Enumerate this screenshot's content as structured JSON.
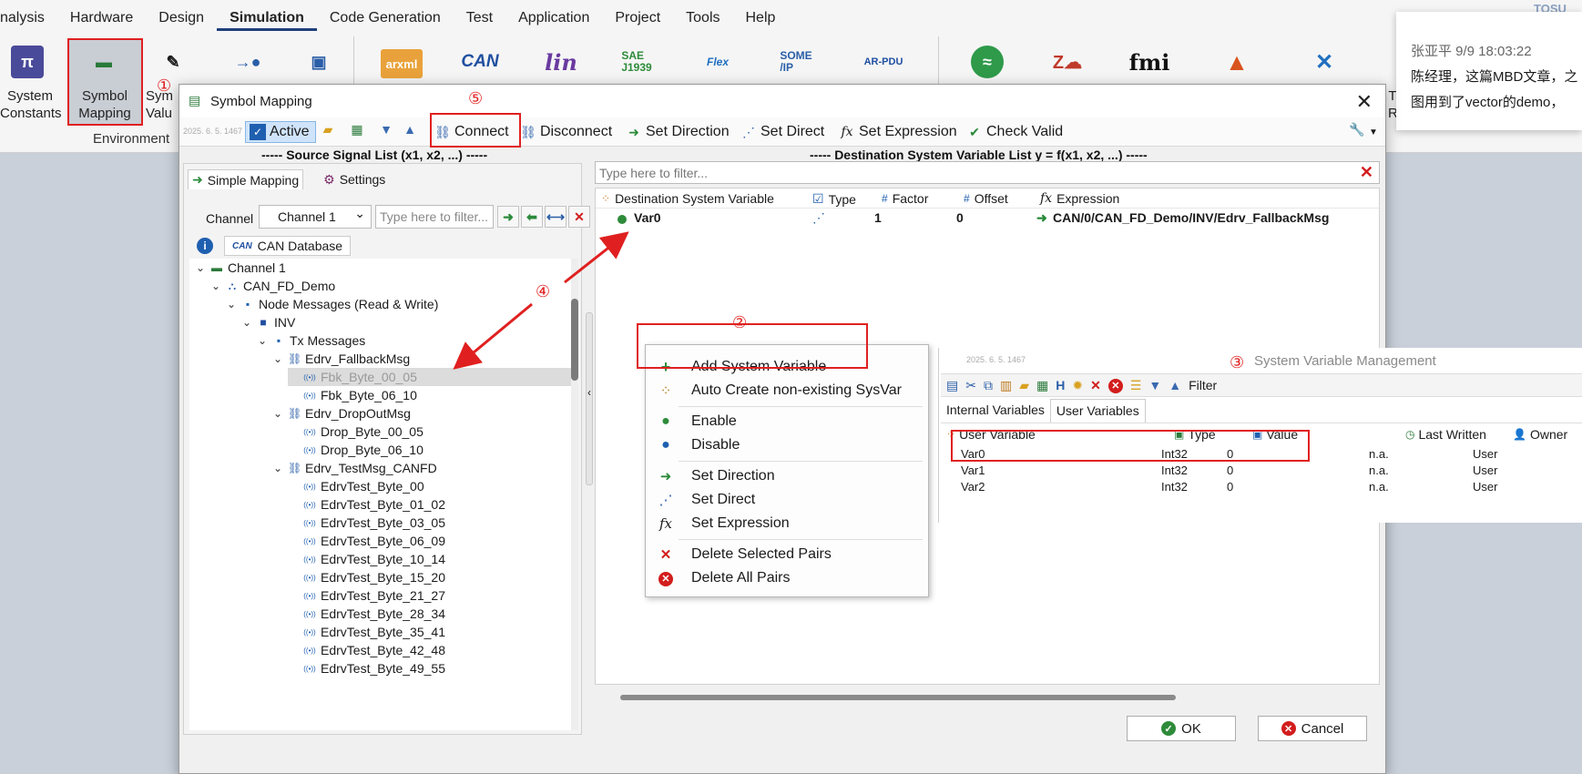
{
  "menubar": [
    "nalysis",
    "Hardware",
    "Design",
    "Simulation",
    "Code Generation",
    "Test",
    "Application",
    "Project",
    "Tools",
    "Help"
  ],
  "menubar_active": "Simulation",
  "ribbon": {
    "system_constants": "System\nConstants",
    "symbol_mapping": "Symbol\nMapping",
    "symbol_value": "Sym\nValu",
    "environment_group": "Environment",
    "partial_right": "T\nRP",
    "icons": {
      "arxml": "arxml",
      "can": "CAN",
      "lin": "lin",
      "sae": "SAE\nJ1939",
      "flex": "Flex",
      "someip": "SOME\n/IP",
      "arpdu": "AR-PDU",
      "fmi": "fmi"
    }
  },
  "comment": {
    "meta": "张亚平 9/9 18:03:22",
    "line1": "陈经理，这篇MBD文章，之",
    "line2": "图用到了vector的demo，",
    "top_corner": "TOSU"
  },
  "dialog": {
    "title": "Symbol Mapping",
    "watermark": "2025. 6. 5. 1467",
    "toolbar": {
      "active": "Active",
      "connect": "Connect",
      "disconnect": "Disconnect",
      "set_direction": "Set Direction",
      "set_direct": "Set Direct",
      "set_expression": "Set Expression",
      "check_valid": "Check Valid"
    },
    "source_header": "----- Source Signal List (x1, x2, ...) -----",
    "dest_header": "----- Destination System Variable List y = f(x1, x2, ...) -----",
    "left_tabs": {
      "simple": "Simple Mapping",
      "settings": "Settings"
    },
    "channel_label": "Channel",
    "channel_value": "Channel 1",
    "left_filter_placeholder": "Type here to filter...",
    "db_tab": "CAN Database",
    "tree": [
      {
        "label": "Channel 1",
        "level": 0,
        "caret": "v",
        "kind": "channel"
      },
      {
        "label": "CAN_FD_Demo",
        "level": 1,
        "caret": "v",
        "kind": "network"
      },
      {
        "label": "Node Messages (Read & Write)",
        "level": 2,
        "caret": "v",
        "kind": "folder"
      },
      {
        "label": "INV",
        "level": 3,
        "caret": "v",
        "kind": "node"
      },
      {
        "label": "Tx Messages",
        "level": 4,
        "caret": "v",
        "kind": "folder"
      },
      {
        "label": "Edrv_FallbackMsg",
        "level": 5,
        "caret": "v",
        "kind": "msg"
      },
      {
        "label": "Fbk_Byte_00_05",
        "level": 6,
        "caret": "",
        "kind": "sig",
        "selected": true
      },
      {
        "label": "Fbk_Byte_06_10",
        "level": 6,
        "caret": "",
        "kind": "sig"
      },
      {
        "label": "Edrv_DropOutMsg",
        "level": 5,
        "caret": "v",
        "kind": "msg"
      },
      {
        "label": "Drop_Byte_00_05",
        "level": 6,
        "caret": "",
        "kind": "sig"
      },
      {
        "label": "Drop_Byte_06_10",
        "level": 6,
        "caret": "",
        "kind": "sig"
      },
      {
        "label": "Edrv_TestMsg_CANFD",
        "level": 5,
        "caret": "v",
        "kind": "msg"
      },
      {
        "label": "EdrvTest_Byte_00",
        "level": 6,
        "caret": "",
        "kind": "sig"
      },
      {
        "label": "EdrvTest_Byte_01_02",
        "level": 6,
        "caret": "",
        "kind": "sig"
      },
      {
        "label": "EdrvTest_Byte_03_05",
        "level": 6,
        "caret": "",
        "kind": "sig"
      },
      {
        "label": "EdrvTest_Byte_06_09",
        "level": 6,
        "caret": "",
        "kind": "sig"
      },
      {
        "label": "EdrvTest_Byte_10_14",
        "level": 6,
        "caret": "",
        "kind": "sig"
      },
      {
        "label": "EdrvTest_Byte_15_20",
        "level": 6,
        "caret": "",
        "kind": "sig"
      },
      {
        "label": "EdrvTest_Byte_21_27",
        "level": 6,
        "caret": "",
        "kind": "sig"
      },
      {
        "label": "EdrvTest_Byte_28_34",
        "level": 6,
        "caret": "",
        "kind": "sig"
      },
      {
        "label": "EdrvTest_Byte_35_41",
        "level": 6,
        "caret": "",
        "kind": "sig"
      },
      {
        "label": "EdrvTest_Byte_42_48",
        "level": 6,
        "caret": "",
        "kind": "sig"
      },
      {
        "label": "EdrvTest_Byte_49_55",
        "level": 6,
        "caret": "",
        "kind": "sig"
      }
    ],
    "right_filter_placeholder": "Type here to filter...",
    "dest_columns": {
      "var": "Destination System Variable",
      "type": "Type",
      "factor": "Factor",
      "offset": "Offset",
      "expr": "Expression"
    },
    "dest_row": {
      "var": "Var0",
      "factor": "1",
      "offset": "0",
      "expr": "CAN/0/CAN_FD_Demo/INV/Edrv_FallbackMsg"
    },
    "ok": "OK",
    "cancel": "Cancel"
  },
  "context_menu": {
    "add": "Add System Variable",
    "auto": "Auto Create non-existing SysVar",
    "enable": "Enable",
    "disable": "Disable",
    "set_direction": "Set Direction",
    "set_direct": "Set Direct",
    "set_expression": "Set Expression",
    "delete_selected": "Delete Selected Pairs",
    "delete_all": "Delete All Pairs"
  },
  "svm": {
    "title": "System Variable Management",
    "watermark": "2025. 6. 5. 1467",
    "filter": "Filter",
    "tabs": {
      "internal": "Internal Variables",
      "user": "User Variables"
    },
    "columns": {
      "user_var": "User Variable",
      "type": "Type",
      "value": "Value",
      "last": "Last Written",
      "owner": "Owner"
    },
    "rows": [
      {
        "name": "Var0",
        "type": "Int32",
        "value": "0",
        "last": "n.a.",
        "owner": "User"
      },
      {
        "name": "Var1",
        "type": "Int32",
        "value": "0",
        "last": "n.a.",
        "owner": "User"
      },
      {
        "name": "Var2",
        "type": "Int32",
        "value": "0",
        "last": "n.a.",
        "owner": "User"
      }
    ]
  },
  "annotations": {
    "n1": "①",
    "n2": "②",
    "n3": "③",
    "n4": "④",
    "n5": "⑤"
  },
  "colors": {
    "annotation_red": "#e02020",
    "accent_blue": "#1f3f7a",
    "green": "#2e8b3a"
  }
}
